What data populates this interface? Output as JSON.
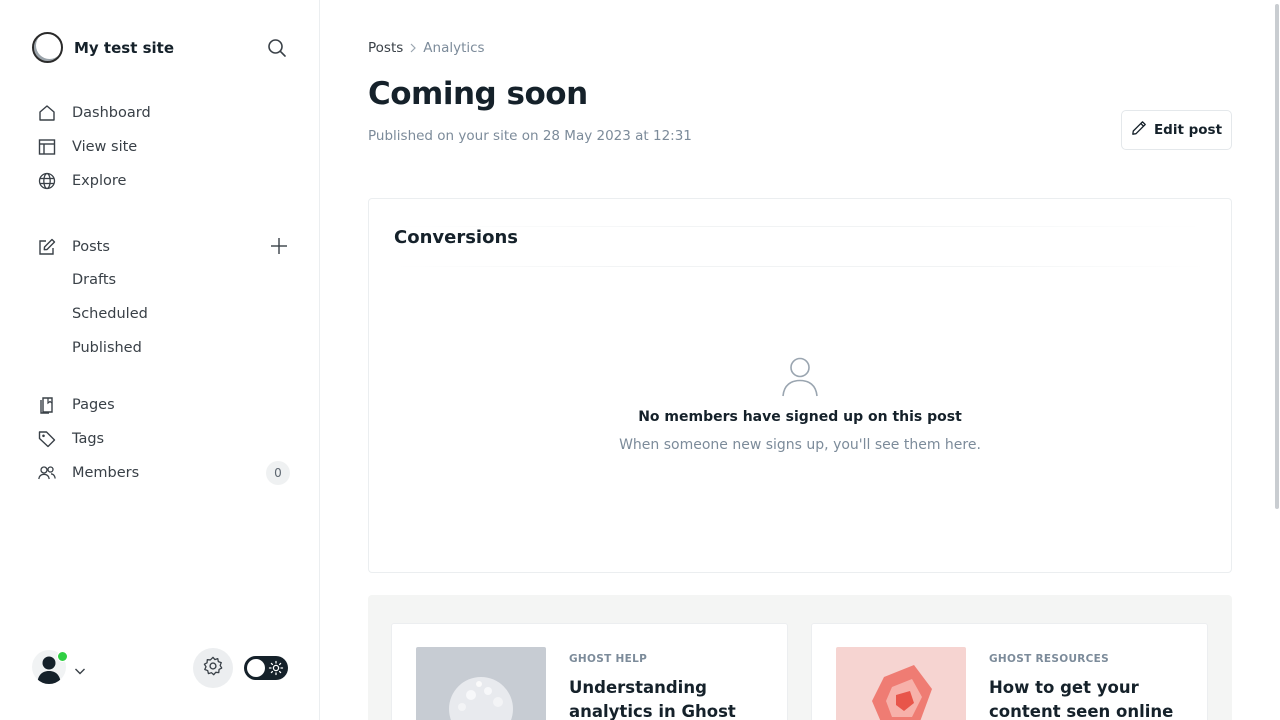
{
  "sidebar": {
    "site_name": "My test site",
    "nav": {
      "dashboard": "Dashboard",
      "view_site": "View site",
      "explore": "Explore",
      "posts": "Posts",
      "drafts": "Drafts",
      "scheduled": "Scheduled",
      "published": "Published",
      "pages": "Pages",
      "tags": "Tags",
      "members": "Members",
      "members_count": "0"
    }
  },
  "breadcrumb": {
    "parent": "Posts",
    "current": "Analytics"
  },
  "post": {
    "title": "Coming soon",
    "meta": "Published on your site on 28 May 2023 at 12:31",
    "edit_label": "Edit post"
  },
  "conversions": {
    "title": "Conversions",
    "empty_title": "No members have signed up on this post",
    "empty_desc": "When someone new signs up, you'll see them here."
  },
  "resources": [
    {
      "category": "GHOST HELP",
      "title": "Understanding analytics in Ghost"
    },
    {
      "category": "GHOST RESOURCES",
      "title": "How to get your content seen online"
    }
  ],
  "colors": {
    "accent_online": "#30cf43",
    "text_primary": "#15212a",
    "text_muted": "#7c8b9a"
  }
}
